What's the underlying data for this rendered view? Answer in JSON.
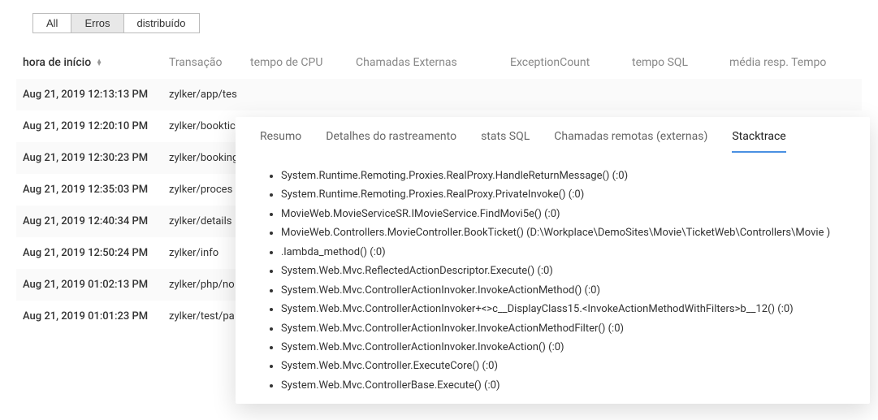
{
  "filters": {
    "all": "All",
    "errors": "Erros",
    "distributed": "distribuído"
  },
  "columns": {
    "start": "hora de início",
    "transaction": "Transação",
    "cpu": "tempo de CPU",
    "external": "Chamadas Externas",
    "exception": "ExceptionCount",
    "sql": "tempo SQL",
    "avg": "média resp. Tempo"
  },
  "rows": [
    {
      "time": "Aug 21, 2019 12:13:13 PM",
      "trans": "zylker/app/tes"
    },
    {
      "time": "Aug 21, 2019 12:20:10 PM",
      "trans": "zylker/booktic"
    },
    {
      "time": "Aug 21, 2019 12:30:23 PM",
      "trans": "zylker/bookingse"
    },
    {
      "time": "Aug 21, 2019 12:35:03 PM",
      "trans": "zylker/proces"
    },
    {
      "time": "Aug 21, 2019 12:40:34 PM",
      "trans": "zylker/details"
    },
    {
      "time": "Aug 21, 2019 12:50:24 PM",
      "trans": "zylker/info"
    },
    {
      "time": "Aug 21, 2019 01:02:13 PM",
      "trans": "zylker/php/no"
    },
    {
      "time": "Aug 21, 2019 01:01:23 PM",
      "trans": "zylker/test/pa"
    }
  ],
  "popover": {
    "tabs": {
      "summary": "Resumo",
      "trace": "Detalhes do rastreamento",
      "sql": "stats SQL",
      "remote": "Chamadas remotas (externas)",
      "stack": "Stacktrace"
    },
    "stack": [
      "System.Runtime.Remoting.Proxies.RealProxy.HandleReturnMessage() (:0)",
      "System.Runtime.Remoting.Proxies.RealProxy.PrivateInvoke() (:0)",
      "MovieWeb.MovieServiceSR.IMovieService.FindMovi5e() (:0)",
      "MovieWeb.Controllers.MovieController.BookTicket() (D:\\Workplace\\DemoSites\\Movie\\TicketWeb\\Controllers\\Movie )",
      ".lambda_method() (:0)",
      "System.Web.Mvc.ReflectedActionDescriptor.Execute() (:0)",
      "System.Web.Mvc.ControllerActionInvoker.InvokeActionMethod() (:0)",
      "System.Web.Mvc.ControllerActionInvoker+<>c__DisplayClass15.<InvokeActionMethodWithFilters>b__12() (:0)",
      "System.Web.Mvc.ControllerActionInvoker.InvokeActionMethodFilter() (:0)",
      "System.Web.Mvc.ControllerActionInvoker.InvokeAction() (:0)",
      "System.Web.Mvc.Controller.ExecuteCore() (:0)",
      "System.Web.Mvc.ControllerBase.Execute() (:0)"
    ]
  }
}
